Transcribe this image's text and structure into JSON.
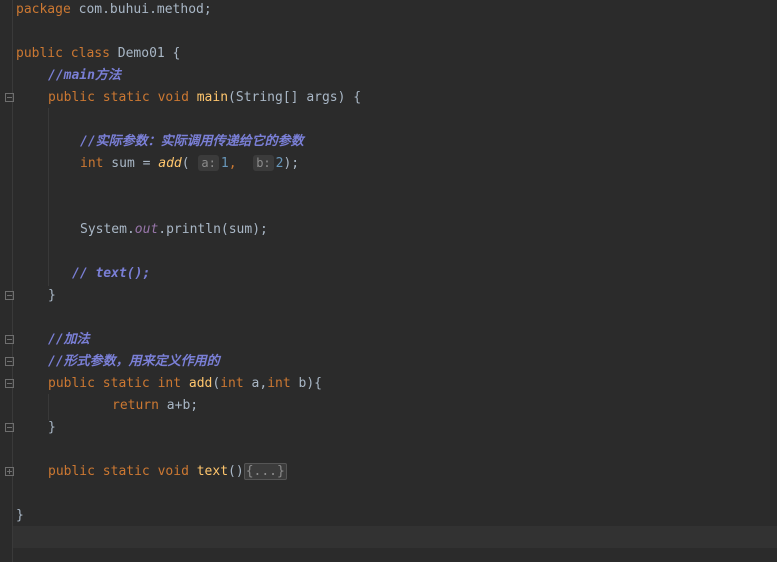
{
  "editor": {
    "language": "java",
    "lines": {
      "pkg_kw": "package",
      "pkg_name": "com.buhui.method;",
      "class_public": "public",
      "class_kw": "class",
      "class_name": "Demo01 {",
      "main_comment": "//main方法",
      "main_public": "public",
      "main_static": "static",
      "main_void": "void",
      "main_name": "main",
      "main_params": "(String[] args) {",
      "actual_comment": "//实际参数：实际调用传递给它的参数",
      "int_kw": "int",
      "sum_assign": " sum = ",
      "add_call": "add",
      "open_paren": "(",
      "hint_a": "a:",
      "arg1": "1",
      "comma": ",",
      "hint_b": "b:",
      "arg2": "2",
      "close_call": ");",
      "system": "System.",
      "out": "out",
      "println": ".println(sum);",
      "text_comment": "// text();",
      "close_main": "}",
      "add_comment": "//加法",
      "formal_comment": "//形式参数，用来定义作用的",
      "add_public": "public",
      "add_static": "static",
      "add_int": "int",
      "add_name": "add",
      "add_params_open": "(",
      "add_int_a": "int",
      "add_a": " a,",
      "add_int_b": "int",
      "add_b": " b){",
      "return_kw": "return",
      "return_expr": " a+b;",
      "close_add": "}",
      "text_public": "public",
      "text_static": "static",
      "text_void": "void",
      "text_name": "text",
      "text_parens": "()",
      "text_folded": "{...}",
      "close_class": "}"
    }
  },
  "colors": {
    "background": "#2b2b2b",
    "keyword": "#cc7832",
    "method": "#ffc66d",
    "number": "#6897bb",
    "static_field": "#9876aa",
    "doc_comment": "#7a7fd6",
    "text": "#a9b7c6"
  },
  "icons": {
    "fold": "fold-marker-icon"
  }
}
